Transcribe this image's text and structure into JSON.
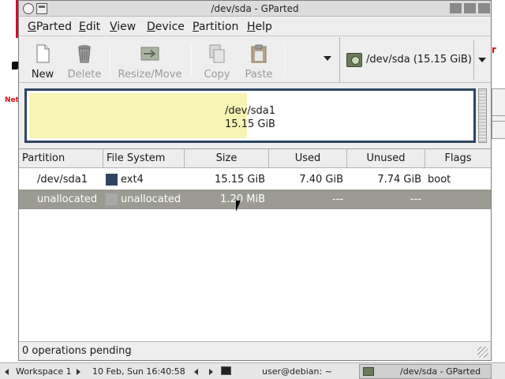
{
  "window": {
    "title": "/dev/sda - GParted"
  },
  "menubar": {
    "items": [
      {
        "label": "GParted",
        "accel": "G",
        "rest": "Parted"
      },
      {
        "label": "Edit",
        "accel": "E",
        "rest": "dit"
      },
      {
        "label": "View",
        "accel": "V",
        "rest": "iew"
      },
      {
        "label": "Device",
        "accel": "D",
        "rest": "evice"
      },
      {
        "label": "Partition",
        "accel": "P",
        "rest": "artition"
      },
      {
        "label": "Help",
        "accel": "H",
        "rest": "elp"
      }
    ]
  },
  "toolbar": {
    "new_label": "New",
    "delete_label": "Delete",
    "resize_move_label": "Resize/Move",
    "copy_label": "Copy",
    "paste_label": "Paste",
    "device_selector": "/dev/sda  (15.15 GiB)"
  },
  "diskmap": {
    "partition_name": "/dev/sda1",
    "partition_size": "15.15 GiB",
    "used_fraction": 0.49
  },
  "table": {
    "headers": [
      "Partition",
      "File System",
      "Size",
      "Used",
      "Unused",
      "Flags"
    ],
    "rows": [
      {
        "partition": "/dev/sda1",
        "filesystem": "ext4",
        "fs_color": "#2d4562",
        "size": "15.15 GiB",
        "used": "7.40 GiB",
        "unused": "7.74 GiB",
        "flags": "boot",
        "selected": false
      },
      {
        "partition": "unallocated",
        "filesystem": "unallocated",
        "fs_color": "#a8a8a8",
        "size": "1.20 MiB",
        "used": "---",
        "unused": "---",
        "flags": "",
        "selected": true
      }
    ]
  },
  "statusbar": {
    "text": "0 operations pending"
  },
  "taskbar": {
    "workspace": "Workspace 1",
    "clock": "10 Feb, Sun 16:40:58",
    "terminal_task": "user@debian: ~",
    "gparted_task": "/dev/sda - GParted"
  },
  "colors": {
    "partition_border": "#2d4562",
    "used_fill": "#f7f4b4",
    "selected_row": "#9b9b93"
  },
  "icons": [
    "new-icon",
    "delete-icon",
    "resize-move-icon",
    "copy-icon",
    "paste-icon",
    "disk-icon"
  ]
}
